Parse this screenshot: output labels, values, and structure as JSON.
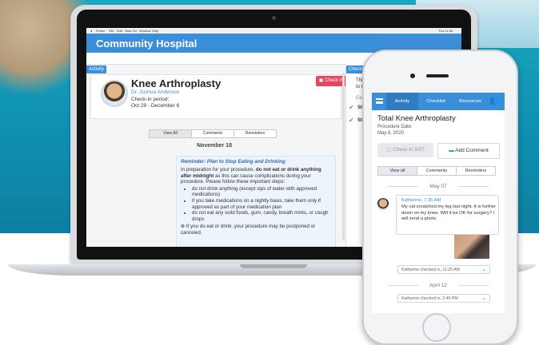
{
  "desktop": {
    "menubar": [
      "Finder",
      "File",
      "Edit",
      "View",
      "Go",
      "Window",
      "Help"
    ],
    "clock": "Thu 21:58",
    "hospital_name": "Community Hospital",
    "activity_tag": "Activity",
    "checklist_tag": "Checklist",
    "procedure": "Knee Arthroplasty",
    "doctor": "Dr. Joshua Anderson",
    "checkin_period_label": "Check-in period:",
    "checkin_period": "Oct 29 - December 6",
    "checkin_button": "Check in",
    "tabs": [
      "View All",
      "Comments",
      "Reminders"
    ],
    "date_separator": "November 18",
    "reminder": {
      "title": "Reminder: Plan to Stop Eating and Drinking",
      "intro_1": "In preparation for your procedure,",
      "intro_bold": "do not eat or drink anything after midnight",
      "intro_2": "as this can cause complications during your procedure. Please follow these important steps:",
      "bullets": [
        "do not drink anything (except sips of water with approved medications)",
        "if you take medications on a nightly basis, take them only if approved as part of your medication plan",
        "do not eat any solid foods, gum, candy, breath mints, or cough drops"
      ],
      "footer": "⊗ If you do eat or drink, your procedure may be postponed or canceled."
    },
    "checklist_snippets": [
      "This",
      "to he",
      "Com",
      "Sta",
      "Sta"
    ]
  },
  "phone": {
    "tabs": [
      "Activity",
      "Checklist",
      "Resources"
    ],
    "title": "Total Knee Arthroplasty",
    "date_label": "Procedure Date:",
    "date": "May 8, 2020",
    "checkin_btn": "Check in 5/07",
    "comment_btn": "Add Comment",
    "filters": [
      "View all",
      "Comments",
      "Reminders"
    ],
    "sep1": "May 07",
    "comment_name": "Katherine, 7:35 AM",
    "comment_text": "My cat scratched my leg last night. It is further down on my knee. Will it be OK for surgery? I will send a photo.",
    "checkin1": "Katherine checked in, 11:25 AM",
    "sep2": "April 12",
    "checkin2": "Katherine checked in, 2:45 PM"
  }
}
